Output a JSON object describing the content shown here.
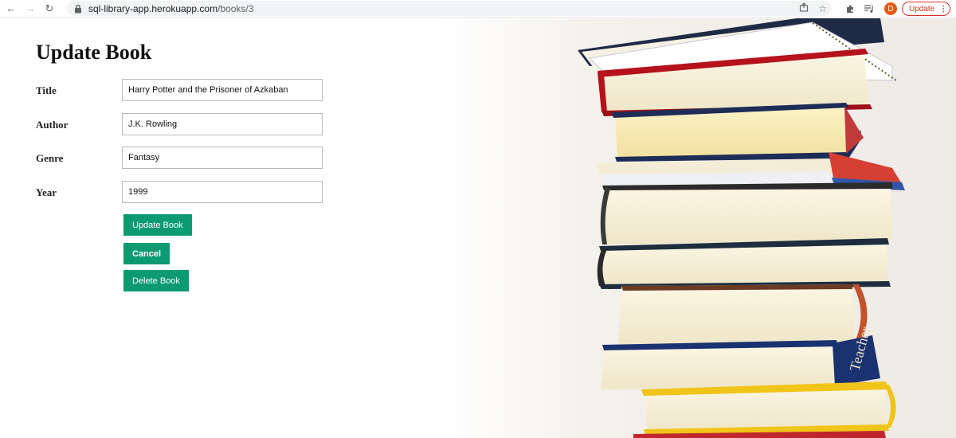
{
  "browser": {
    "url_host": "sql-library-app.herokuapp.com",
    "url_path": "/books/3",
    "profile_initial": "D",
    "update_label": "Update",
    "icons": [
      "back-arrow-icon",
      "forward-arrow-icon",
      "reload-icon",
      "lock-icon",
      "share-icon",
      "star-icon",
      "extensions-icon",
      "media-icon",
      "more-icon"
    ]
  },
  "page": {
    "title": "Update Book",
    "fields": [
      {
        "label": "Title",
        "value": "Harry Potter and the Prisoner of Azkaban"
      },
      {
        "label": "Author",
        "value": "J.K. Rowling"
      },
      {
        "label": "Genre",
        "value": "Fantasy"
      },
      {
        "label": "Year",
        "value": "1999"
      }
    ],
    "buttons": {
      "update": "Update Book",
      "cancel": "Cancel",
      "delete": "Delete Book"
    },
    "accent_color": "#0b9a71",
    "spine_text": "Teacher"
  }
}
